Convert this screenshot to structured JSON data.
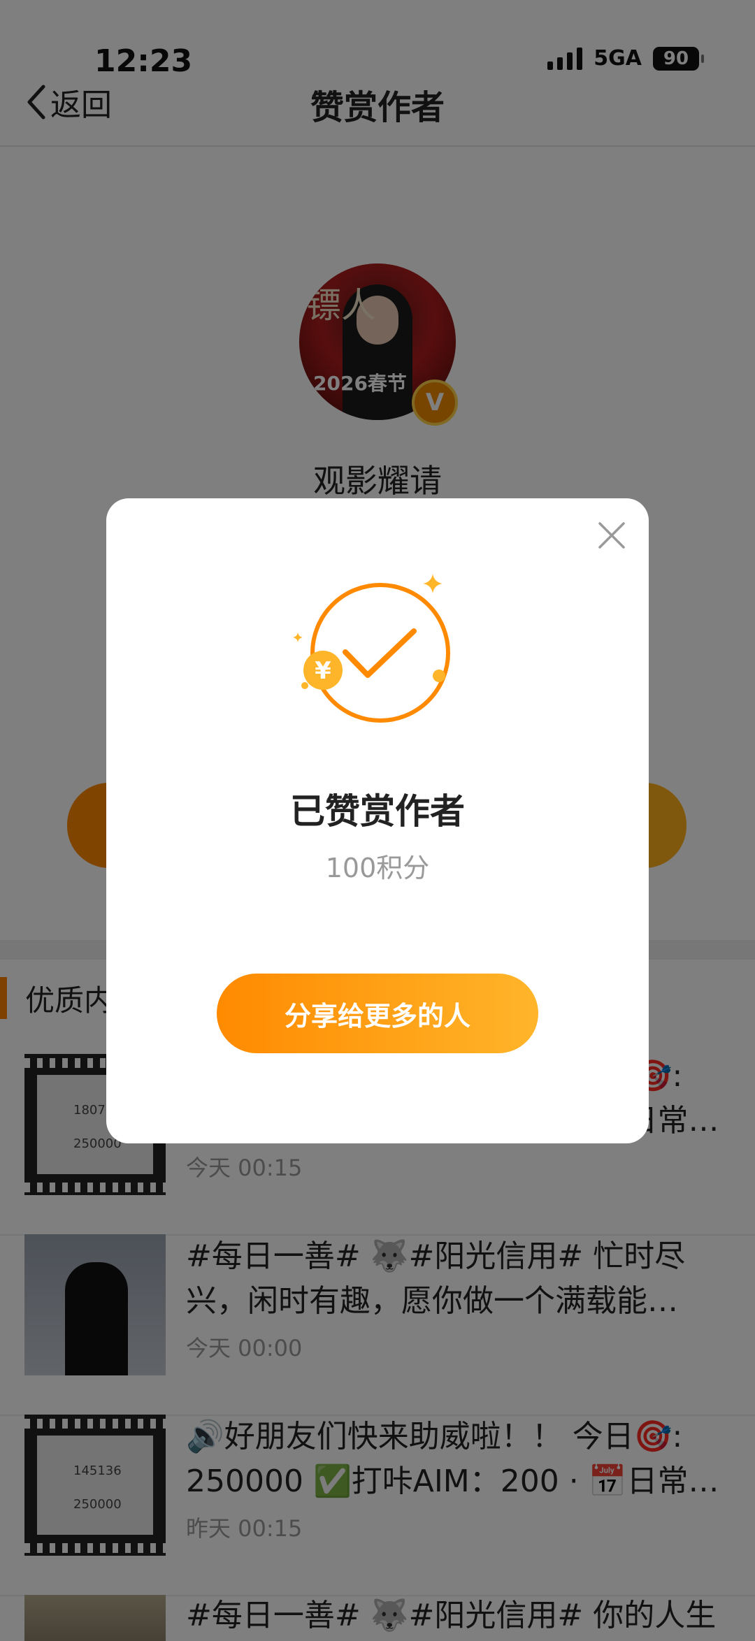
{
  "status_bar": {
    "time": "12:23",
    "network": "5GA",
    "battery": "90"
  },
  "nav": {
    "back_label": "返回",
    "title": "赞赏作者"
  },
  "author": {
    "name": "观影耀请",
    "avatar_text_1": "镖人",
    "avatar_text_2": "2026春节"
  },
  "section": {
    "title": "优质内容"
  },
  "feed": [
    {
      "text_line1": "🔊好朋友们快来助威啦！！ 今日🎯:",
      "text_line2": "250000 ✅打咔AIM：200 · 📅日常…",
      "time": "今天 00:15",
      "thumb_n1": "180731",
      "thumb_n2": "250000"
    },
    {
      "text_line1": "#每日一善# 🐺#阳光信用# 忙时尽",
      "text_line2": "兴，闲时有趣，愿你做一个满载能…",
      "time": "今天 00:00"
    },
    {
      "text_line1": "🔊好朋友们快来助威啦！！ 今日🎯:",
      "text_line2": "250000 ✅打咔AIM：200 · 📅日常…",
      "time": "昨天 00:15",
      "thumb_n1": "145136",
      "thumb_n2": "250000"
    },
    {
      "text_line1": "#每日一善# 🐺#阳光信用# 你的人生",
      "text_line2": "",
      "time": ""
    }
  ],
  "modal": {
    "title": "已赞赏作者",
    "subtitle": "100积分",
    "share_button": "分享给更多的人",
    "coin_symbol": "¥"
  },
  "colors": {
    "accent": "#ff8a00",
    "accent_light": "#ffb52a",
    "overlay": "rgba(0,0,0,0.5)"
  }
}
